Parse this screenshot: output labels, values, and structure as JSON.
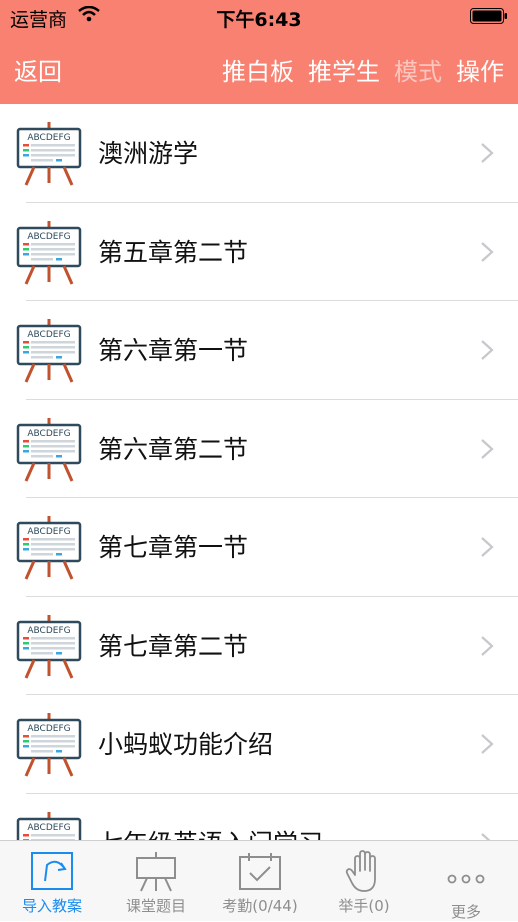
{
  "status_bar": {
    "carrier": "运营商",
    "time": "下午6:43"
  },
  "nav": {
    "back_label": "返回",
    "actions": [
      {
        "label": "推白板",
        "dim": false
      },
      {
        "label": "推学生",
        "dim": false
      },
      {
        "label": "模式",
        "dim": true
      },
      {
        "label": "操作",
        "dim": false
      }
    ]
  },
  "list": {
    "icon_text": "ABCDEFG",
    "items": [
      {
        "label": "澳洲游学"
      },
      {
        "label": "第五章第二节"
      },
      {
        "label": "第六章第一节"
      },
      {
        "label": "第六章第二节"
      },
      {
        "label": "第七章第一节"
      },
      {
        "label": "第七章第二节"
      },
      {
        "label": "小蚂蚁功能介绍"
      },
      {
        "label": "七年级英语入门学习"
      }
    ]
  },
  "tabbar": {
    "tabs": [
      {
        "label": "导入教案",
        "icon": "import-lesson-icon",
        "active": true
      },
      {
        "label": "课堂题目",
        "icon": "easel-icon",
        "active": false
      },
      {
        "label": "考勤(0/44)",
        "icon": "attendance-calendar-icon",
        "active": false
      },
      {
        "label": "举手(0)",
        "icon": "raise-hand-icon",
        "active": false
      },
      {
        "label": "更多",
        "icon": "more-icon",
        "active": false
      }
    ]
  },
  "colors": {
    "header": "#f98171",
    "active_tab": "#1a8cf0",
    "inactive_tab": "#8e8e8e"
  }
}
